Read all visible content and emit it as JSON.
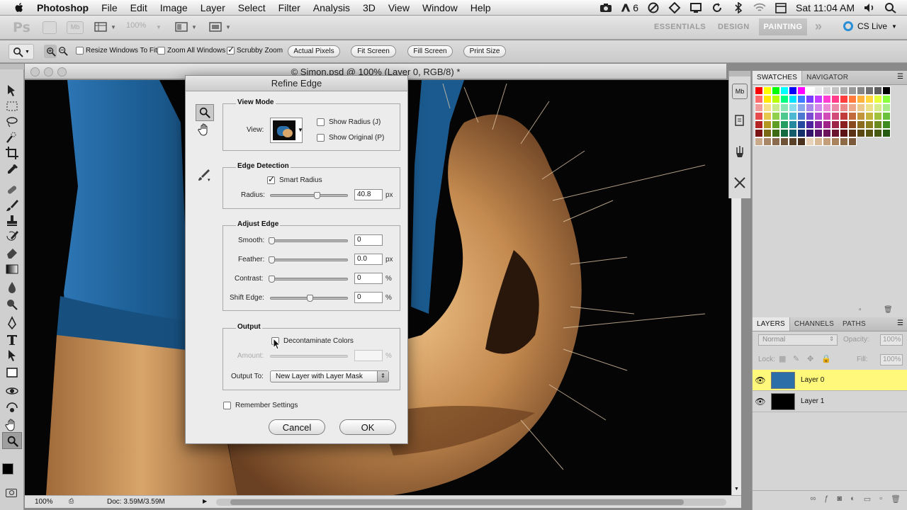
{
  "menubar": {
    "app": "Photoshop",
    "items": [
      "File",
      "Edit",
      "Image",
      "Layer",
      "Select",
      "Filter",
      "Analysis",
      "3D",
      "View",
      "Window",
      "Help"
    ],
    "status": {
      "adobe_badge": "6",
      "clock": "Sat 11:04 AM"
    }
  },
  "appbar": {
    "logo": "Ps",
    "zoom": "100%",
    "workspaces": [
      "ESSENTIALS",
      "DESIGN"
    ],
    "active_workspace": "PAINTING",
    "more": "»",
    "cslive": "CS Live"
  },
  "options": {
    "resize_windows": "Resize Windows To Fit",
    "zoom_all": "Zoom All Windows",
    "scrubby_zoom": "Scrubby Zoom",
    "buttons": [
      "Actual Pixels",
      "Fit Screen",
      "Fill Screen",
      "Print Size"
    ]
  },
  "document": {
    "title": "© Simon.psd @ 100% (Layer 0, RGB/8) *",
    "zoom": "100%",
    "doc_size": "Doc: 3.59M/3.59M"
  },
  "dialog": {
    "title": "Refine Edge",
    "view_mode": {
      "title": "View Mode",
      "view_label": "View:",
      "show_radius": "Show Radius (J)",
      "show_original": "Show Original (P)"
    },
    "edge_detection": {
      "title": "Edge Detection",
      "smart_radius": "Smart Radius",
      "radius_label": "Radius:",
      "radius_value": "40.8",
      "radius_unit": "px",
      "radius_level": 0.6
    },
    "adjust_edge": {
      "title": "Adjust Edge",
      "smooth_label": "Smooth:",
      "smooth_value": "0",
      "feather_label": "Feather:",
      "feather_value": "0.0",
      "feather_unit": "px",
      "contrast_label": "Contrast:",
      "contrast_value": "0",
      "contrast_unit": "%",
      "shift_label": "Shift Edge:",
      "shift_value": "0",
      "shift_unit": "%"
    },
    "output": {
      "title": "Output",
      "decontaminate": "Decontaminate Colors",
      "amount_label": "Amount:",
      "amount_unit": "%",
      "output_to_label": "Output To:",
      "output_to_value": "New Layer with Layer Mask"
    },
    "remember": "Remember Settings",
    "cancel": "Cancel",
    "ok": "OK"
  },
  "panels": {
    "top_tabs": [
      "SWATCHES",
      "NAVIGATOR"
    ],
    "layer_tabs": [
      "LAYERS",
      "CHANNELS",
      "PATHS"
    ],
    "blend_mode": "Normal",
    "opacity_label": "Opacity:",
    "opacity_value": "100%",
    "lock_label": "Lock:",
    "fill_label": "Fill:",
    "fill_value": "100%",
    "layers": [
      {
        "name": "Layer 0"
      },
      {
        "name": "Layer 1"
      }
    ]
  },
  "colors": {
    "hood_blue": "#1d5f96",
    "fur": "#c9955a",
    "layer_selected": "#fff87a",
    "painting_tab": "#bdbdbd"
  }
}
